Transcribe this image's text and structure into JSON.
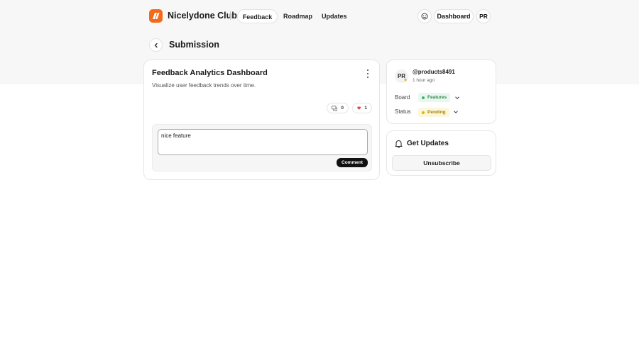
{
  "header": {
    "brand": "Nicelydone Club",
    "nav": [
      "Feedback",
      "Roadmap",
      "Updates"
    ],
    "dashboard_label": "Dashboard",
    "user_initials": "PR",
    "logo_color": "#f26b1d"
  },
  "page": {
    "title": "Submission"
  },
  "post": {
    "title": "Feedback Analytics Dashboard",
    "description": "Visualize user feedback trends over time.",
    "comment_count": "0",
    "like_count": "1",
    "comment_value": "nice feature",
    "comment_button": "Comment"
  },
  "meta": {
    "avatar_initials": "PR",
    "username": "@products8491",
    "time_ago": "1 hour ago",
    "board_label": "Board",
    "board_value": "Features",
    "status_label": "Status",
    "status_value": "Pending",
    "board_color": "#3bb36a",
    "status_color": "#e0b800"
  },
  "updates": {
    "title": "Get Updates",
    "unsubscribe_label": "Unsubscribe"
  },
  "icons": [
    "logo-icon",
    "theme-toggle-icon",
    "back-chevron-icon",
    "more-vertical-icon",
    "comment-icon",
    "heart-icon",
    "star-icon",
    "chevron-down-icon",
    "bell-icon"
  ]
}
